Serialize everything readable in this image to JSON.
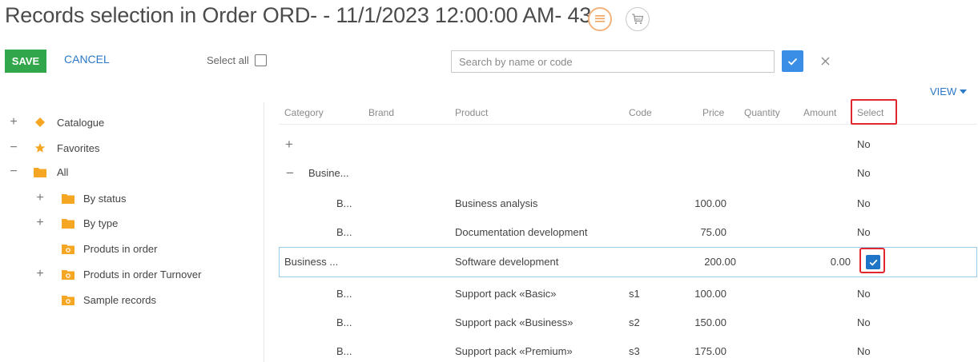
{
  "header": {
    "title": "Records selection in Order ORD- - 11/1/2023 12:00:00 AM- 431",
    "list_icon": "list-icon",
    "cart_icon": "cart-icon"
  },
  "toolbar": {
    "save_label": "SAVE",
    "cancel_label": "CANCEL",
    "select_all_label": "Select all",
    "select_all_checked": false
  },
  "search": {
    "placeholder": "Search by name or code",
    "value": ""
  },
  "view": {
    "label": "VIEW"
  },
  "tree": [
    {
      "toggle": "+",
      "icon": "diamond-icon",
      "label": "Catalogue"
    },
    {
      "toggle": "−",
      "icon": "star-icon",
      "label": "Favorites"
    },
    {
      "toggle": "−",
      "icon": "folder-icon",
      "label": "All"
    },
    {
      "toggle": "+",
      "icon": "folder-icon",
      "label": "By status"
    },
    {
      "toggle": "+",
      "icon": "folder-icon",
      "label": "By type"
    },
    {
      "toggle": "",
      "icon": "dynamic-folder-icon",
      "label": "Produts in order"
    },
    {
      "toggle": "+",
      "icon": "dynamic-folder-icon",
      "label": "Produts in order Turnover"
    },
    {
      "toggle": "",
      "icon": "dynamic-folder-icon",
      "label": "Sample records"
    }
  ],
  "columns": {
    "category": "Category",
    "brand": "Brand",
    "product": "Product",
    "code": "Code",
    "price": "Price",
    "quantity": "Quantity",
    "amount": "Amount",
    "select": "Select"
  },
  "rows": [
    {
      "toggle": "+",
      "category": "",
      "product": "",
      "code": "",
      "price": "",
      "amount": "",
      "select": "No"
    },
    {
      "toggle": "−",
      "category": "Busine...",
      "product": "",
      "code": "",
      "price": "",
      "amount": "",
      "select": "No"
    },
    {
      "toggle": "",
      "category": "B...",
      "product": "Business analysis",
      "code": "",
      "price": "100.00",
      "amount": "",
      "select": "No"
    },
    {
      "toggle": "",
      "category": "B...",
      "product": "Documentation development",
      "code": "",
      "price": "75.00",
      "amount": "",
      "select": "No"
    },
    {
      "toggle": "",
      "category": "Business ...",
      "product": "Software development",
      "code": "",
      "price": "200.00",
      "amount": "0.00",
      "select": "checked"
    },
    {
      "toggle": "",
      "category": "B...",
      "product": "Support pack «Basic»",
      "code": "s1",
      "price": "100.00",
      "amount": "",
      "select": "No"
    },
    {
      "toggle": "",
      "category": "B...",
      "product": "Support pack «Business»",
      "code": "s2",
      "price": "150.00",
      "amount": "",
      "select": "No"
    },
    {
      "toggle": "",
      "category": "B...",
      "product": "Support pack «Premium»",
      "code": "s3",
      "price": "175.00",
      "amount": "",
      "select": "No"
    }
  ],
  "colors": {
    "save": "#31a64a",
    "link": "#2c79c8",
    "accent_orange": "#f3b37c",
    "highlight_red": "#e2262d",
    "checkbox_blue": "#1e74c7"
  }
}
